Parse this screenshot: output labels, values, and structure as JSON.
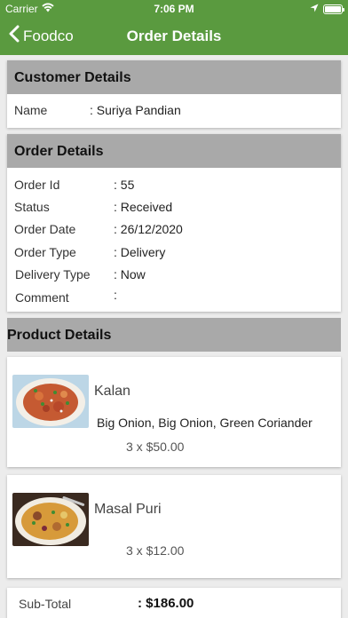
{
  "status_bar": {
    "carrier": "Carrier",
    "time": "7:06 PM"
  },
  "nav": {
    "back_label": "Foodco",
    "title": "Order Details"
  },
  "customer": {
    "header": "Customer Details",
    "name_label": "Name",
    "name_value": ": Suriya  Pandian"
  },
  "order": {
    "header": "Order Details",
    "rows": [
      {
        "label": "Order Id",
        "value": ": 55"
      },
      {
        "label": "Status",
        "value": ": Received"
      },
      {
        "label": "Order Date",
        "value": ": 26/12/2020"
      },
      {
        "label": "Order Type",
        "value": ": Delivery"
      },
      {
        "label": "Delivery Type",
        "value": ": Now"
      },
      {
        "label": "Comment",
        "value": ":"
      }
    ]
  },
  "products": {
    "header": "Product Details",
    "items": [
      {
        "name": "Kalan",
        "description": "Big Onion, Big Onion, Green Coriander",
        "quantity_price": "3 x $50.00"
      },
      {
        "name": "Masal Puri",
        "description": "",
        "quantity_price": "3 x $12.00"
      }
    ]
  },
  "summary": {
    "subtotal_label": "Sub-Total",
    "subtotal_value": ": $186.00"
  },
  "colors": {
    "brand_green": "#5a9a3f",
    "section_header_gray": "#a9a9a9"
  }
}
